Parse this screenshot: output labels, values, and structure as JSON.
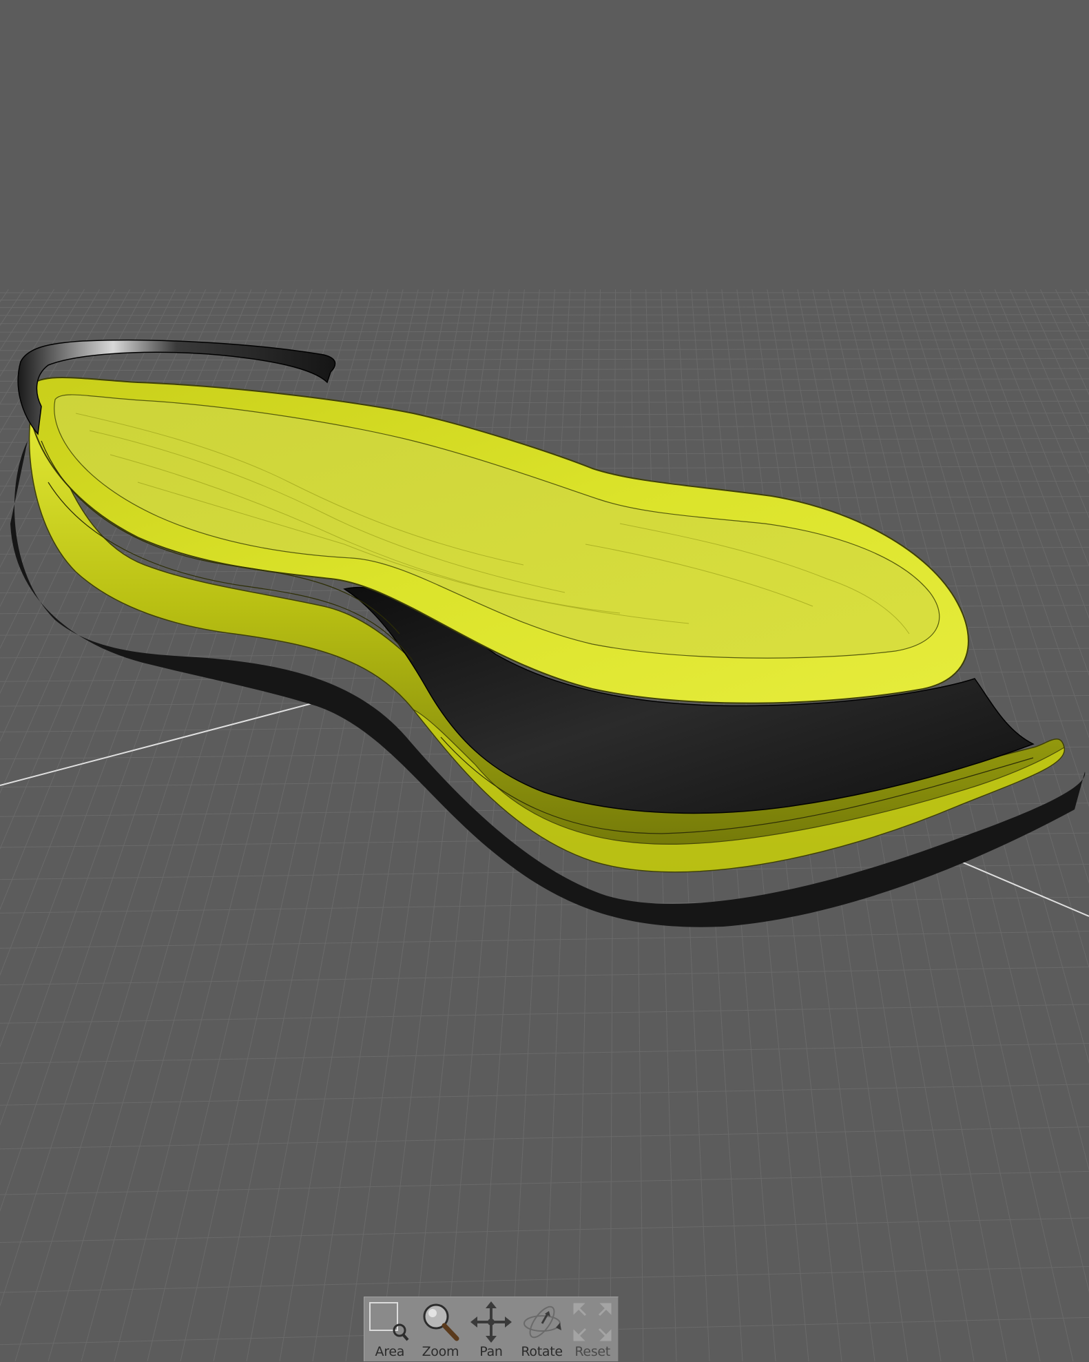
{
  "viewport": {
    "background_color": "#5c5c5c",
    "grid_color": "#6a6a6a",
    "axis_color": "#e8e8e8",
    "model": {
      "midsole_color": "#d6df1f",
      "outsole_color": "#1c1c1c"
    }
  },
  "toolbar": {
    "background_color": "#8a8a8a",
    "tools": [
      {
        "id": "area",
        "label": "Area",
        "icon": "area-zoom-icon"
      },
      {
        "id": "zoom",
        "label": "Zoom",
        "icon": "magnifier-icon"
      },
      {
        "id": "pan",
        "label": "Pan",
        "icon": "pan-arrows-icon"
      },
      {
        "id": "rotate",
        "label": "Rotate",
        "icon": "rotate-orbit-icon"
      },
      {
        "id": "reset",
        "label": "Reset",
        "icon": "reset-view-icon"
      }
    ]
  }
}
